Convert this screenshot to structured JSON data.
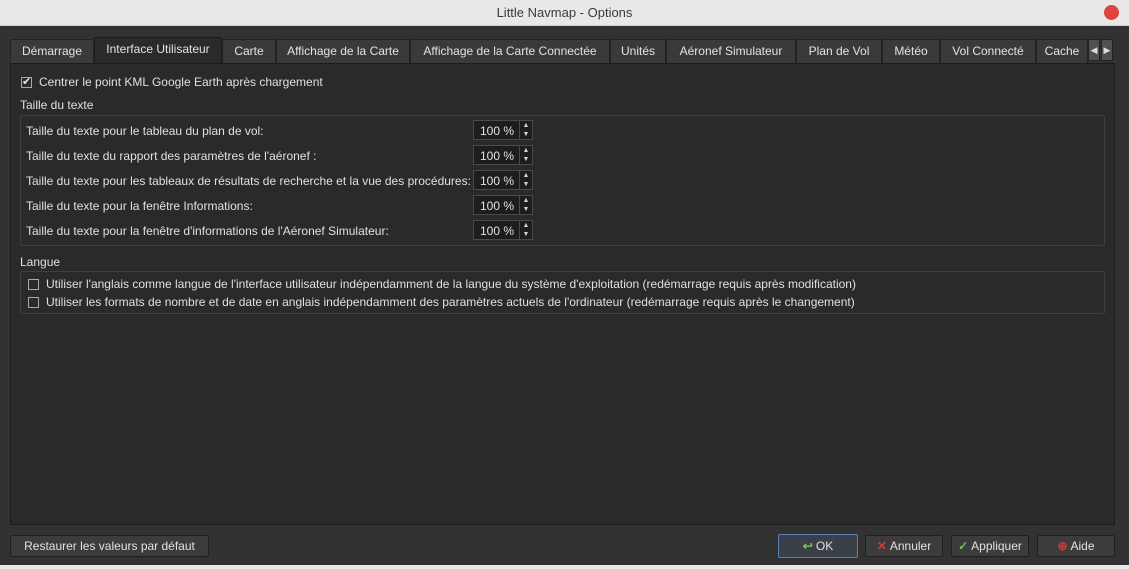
{
  "window": {
    "title": "Little Navmap - Options"
  },
  "tabs": [
    {
      "label": "Démarrage"
    },
    {
      "label": "Interface Utilisateur"
    },
    {
      "label": "Carte"
    },
    {
      "label": "Affichage de la Carte"
    },
    {
      "label": "Affichage de la Carte Connectée"
    },
    {
      "label": "Unités"
    },
    {
      "label": "Aéronef Simulateur"
    },
    {
      "label": "Plan de Vol"
    },
    {
      "label": "Météo"
    },
    {
      "label": "Vol Connecté"
    },
    {
      "label": "Cache"
    }
  ],
  "active_tab": "Interface Utilisateur",
  "kml_checkbox": {
    "label": "Centrer le point KML Google Earth après chargement",
    "checked": true
  },
  "text_size": {
    "title": "Taille du texte",
    "rows": [
      {
        "label": "Taille du texte pour le tableau du plan de vol:",
        "value": "100 %"
      },
      {
        "label": "Taille du texte du rapport des paramètres de l'aéronef :",
        "value": "100 %"
      },
      {
        "label": "Taille du texte pour les tableaux de résultats de recherche et la vue des procédures:",
        "value": "100 %"
      },
      {
        "label": "Taille du texte pour la fenêtre Informations:",
        "value": "100 %"
      },
      {
        "label": "Taille du texte pour la fenêtre d'informations de l'Aéronef Simulateur:",
        "value": "100 %"
      }
    ]
  },
  "language": {
    "title": "Langue",
    "options": [
      {
        "label": "Utiliser l'anglais comme langue de l'interface utilisateur indépendamment de la langue du système d'exploitation (redémarrage requis après modification)",
        "checked": false
      },
      {
        "label": "Utiliser les formats de nombre et de date en anglais indépendamment des paramètres actuels de l'ordinateur (redémarrage requis après le changement)",
        "checked": false
      }
    ]
  },
  "buttons": {
    "restore": "Restaurer les valeurs par défaut",
    "ok": "OK",
    "cancel": "Annuler",
    "apply": "Appliquer",
    "help": "Aide"
  },
  "colors": {
    "accent": "#5a82b0",
    "close": "#e0443e",
    "cancel_icon": "#d03a3a",
    "apply_icon": "#7cc04a"
  }
}
